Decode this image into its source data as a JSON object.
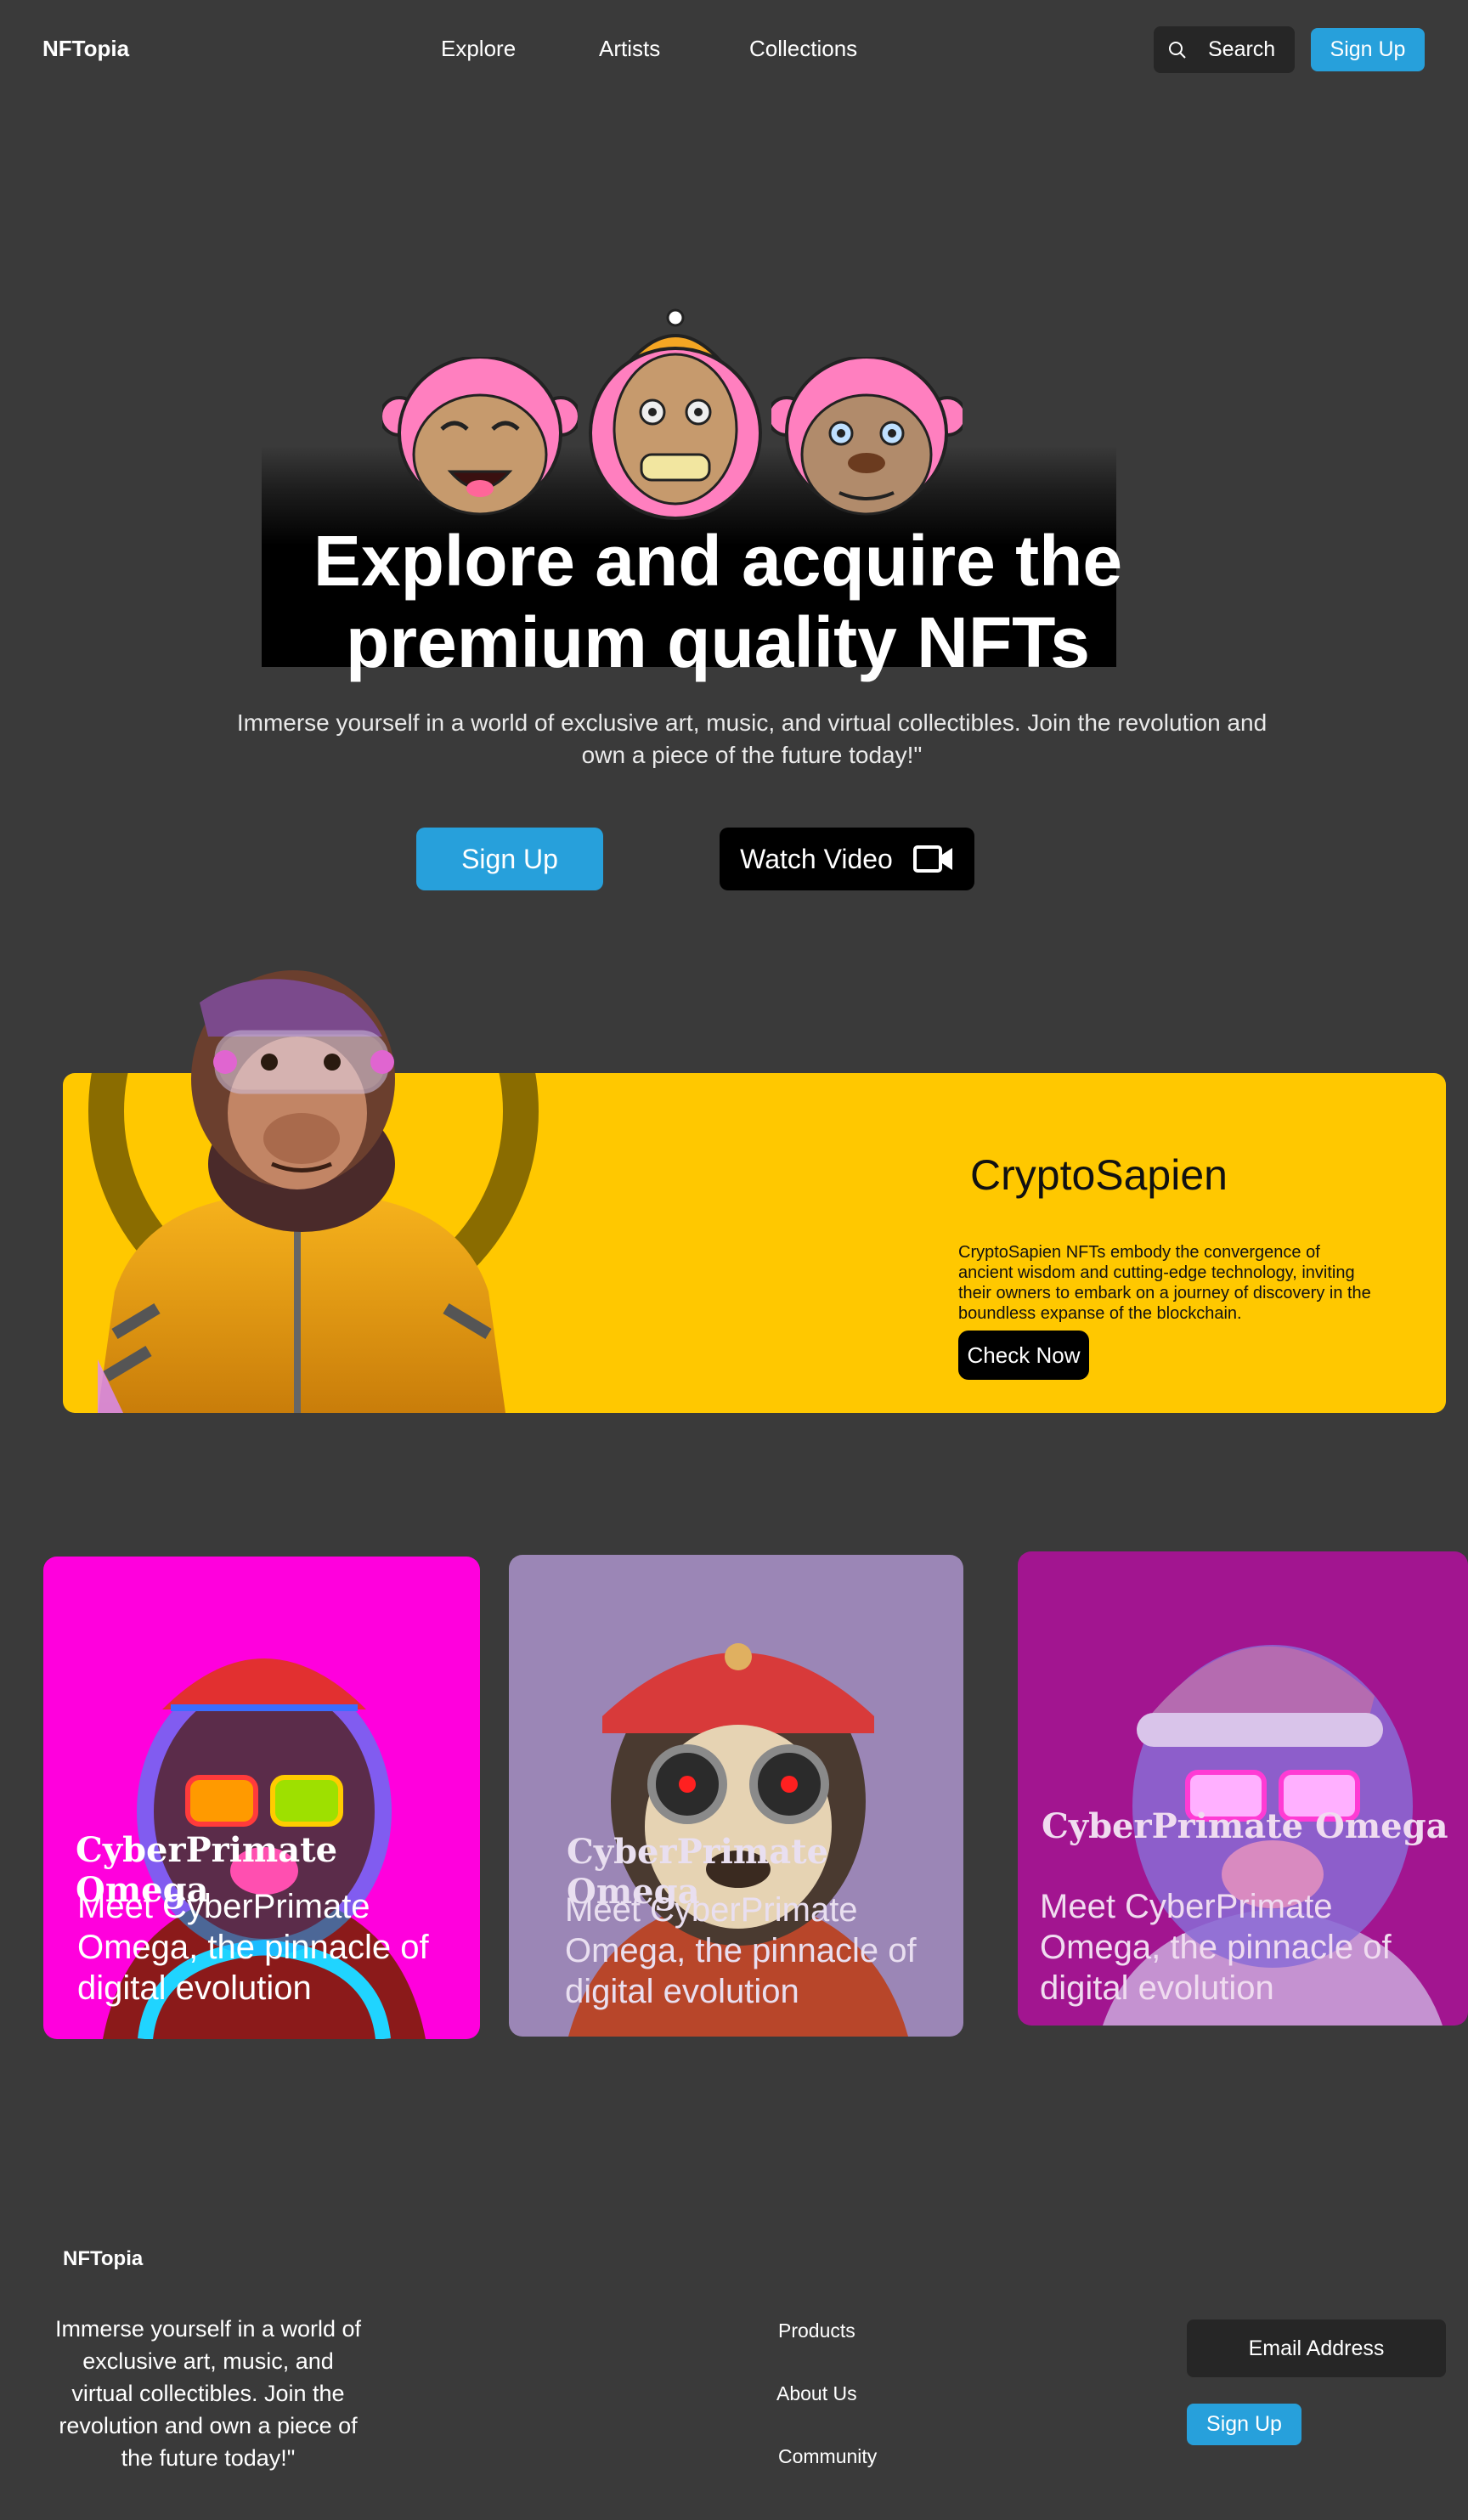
{
  "nav": {
    "logo": "NFTopia",
    "links": [
      "Explore",
      "Artists",
      "Collections"
    ],
    "search_label": "Search",
    "signup_label": "Sign Up"
  },
  "hero": {
    "title_line1": "Explore and acquire the",
    "title_line2": "premium quality NFTs",
    "subtitle": "Immerse yourself in a world of exclusive art, music, and virtual collectibles. Join the revolution and own a piece of the future today!\"",
    "signup_label": "Sign Up",
    "watch_label": "Watch Video"
  },
  "feature": {
    "title": "CryptoSapien",
    "description": "CryptoSapien NFTs embody the convergence of ancient wisdom and cutting-edge technology, inviting their owners to embark on a journey of discovery in the boundless expanse of the blockchain.",
    "cta_label": "Check Now"
  },
  "cards": [
    {
      "title": "CyberPrimate Omega",
      "description": "Meet CyberPrimate Omega, the pinnacle of digital evolution"
    },
    {
      "title": "CyberPrimate Omega",
      "description": "Meet CyberPrimate Omega, the pinnacle of digital evolution"
    },
    {
      "title": "CyberPrimate Omega",
      "description": "Meet CyberPrimate Omega, the pinnacle of digital evolution"
    }
  ],
  "footer": {
    "logo": "NFTopia",
    "text": "Immerse yourself in a world of exclusive art, music, and virtual collectibles. Join the revolution and own a piece of the future today!\"",
    "links": [
      "Products",
      "About Us",
      "Community"
    ],
    "email_placeholder": "Email Address",
    "signup_label": "Sign Up"
  },
  "colors": {
    "background": "#3a3a3a",
    "accent": "#27a0db",
    "feature_bg": "#ffc800",
    "card1_bg": "#ff00dd",
    "card2_bg": "#9b86b6",
    "card3_bg": "#a21590"
  }
}
